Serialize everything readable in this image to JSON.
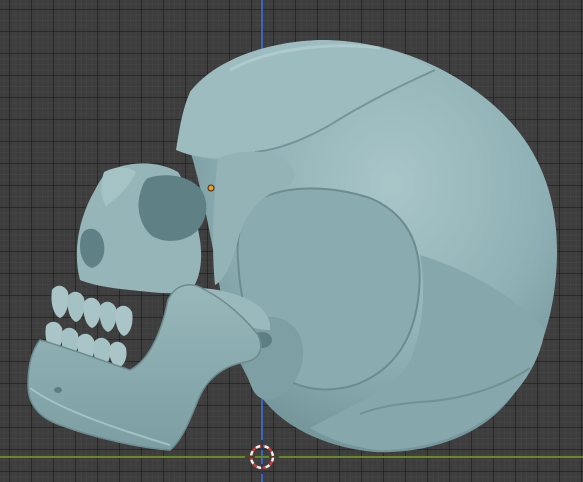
{
  "viewport": {
    "mode": "3d-viewport",
    "view": "right-orthographic",
    "object": "skull",
    "overlays": {
      "grid": true,
      "axis_x": true,
      "axis_y": true,
      "origin_point": true,
      "cursor_3d": true
    }
  },
  "colors": {
    "background": "#3d3d3d",
    "grid_major": "#2a2a2a",
    "axis_x": "#6b8c22",
    "axis_y": "#3b68c9",
    "mesh": "#8eb0b4",
    "mesh_shadow": "#5d7f84",
    "mesh_highlight": "#b6d0d2",
    "origin": "#f0a020",
    "cursor_red": "#d43a3a",
    "cursor_white": "#f0f0f0"
  },
  "icons": {
    "origin": "object-origin-icon",
    "cursor": "3d-cursor-icon"
  }
}
